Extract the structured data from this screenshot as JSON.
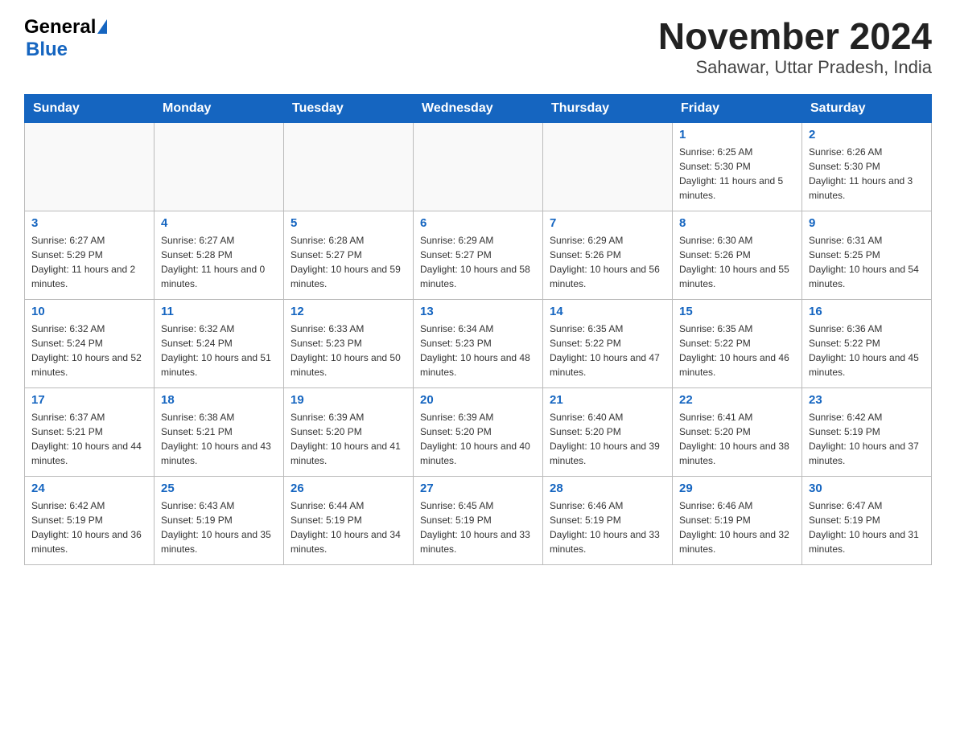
{
  "header": {
    "logo_general": "General",
    "logo_blue": "Blue",
    "title": "November 2024",
    "subtitle": "Sahawar, Uttar Pradesh, India"
  },
  "calendar": {
    "days_of_week": [
      "Sunday",
      "Monday",
      "Tuesday",
      "Wednesday",
      "Thursday",
      "Friday",
      "Saturday"
    ],
    "weeks": [
      [
        {
          "day": "",
          "info": ""
        },
        {
          "day": "",
          "info": ""
        },
        {
          "day": "",
          "info": ""
        },
        {
          "day": "",
          "info": ""
        },
        {
          "day": "",
          "info": ""
        },
        {
          "day": "1",
          "info": "Sunrise: 6:25 AM\nSunset: 5:30 PM\nDaylight: 11 hours and 5 minutes."
        },
        {
          "day": "2",
          "info": "Sunrise: 6:26 AM\nSunset: 5:30 PM\nDaylight: 11 hours and 3 minutes."
        }
      ],
      [
        {
          "day": "3",
          "info": "Sunrise: 6:27 AM\nSunset: 5:29 PM\nDaylight: 11 hours and 2 minutes."
        },
        {
          "day": "4",
          "info": "Sunrise: 6:27 AM\nSunset: 5:28 PM\nDaylight: 11 hours and 0 minutes."
        },
        {
          "day": "5",
          "info": "Sunrise: 6:28 AM\nSunset: 5:27 PM\nDaylight: 10 hours and 59 minutes."
        },
        {
          "day": "6",
          "info": "Sunrise: 6:29 AM\nSunset: 5:27 PM\nDaylight: 10 hours and 58 minutes."
        },
        {
          "day": "7",
          "info": "Sunrise: 6:29 AM\nSunset: 5:26 PM\nDaylight: 10 hours and 56 minutes."
        },
        {
          "day": "8",
          "info": "Sunrise: 6:30 AM\nSunset: 5:26 PM\nDaylight: 10 hours and 55 minutes."
        },
        {
          "day": "9",
          "info": "Sunrise: 6:31 AM\nSunset: 5:25 PM\nDaylight: 10 hours and 54 minutes."
        }
      ],
      [
        {
          "day": "10",
          "info": "Sunrise: 6:32 AM\nSunset: 5:24 PM\nDaylight: 10 hours and 52 minutes."
        },
        {
          "day": "11",
          "info": "Sunrise: 6:32 AM\nSunset: 5:24 PM\nDaylight: 10 hours and 51 minutes."
        },
        {
          "day": "12",
          "info": "Sunrise: 6:33 AM\nSunset: 5:23 PM\nDaylight: 10 hours and 50 minutes."
        },
        {
          "day": "13",
          "info": "Sunrise: 6:34 AM\nSunset: 5:23 PM\nDaylight: 10 hours and 48 minutes."
        },
        {
          "day": "14",
          "info": "Sunrise: 6:35 AM\nSunset: 5:22 PM\nDaylight: 10 hours and 47 minutes."
        },
        {
          "day": "15",
          "info": "Sunrise: 6:35 AM\nSunset: 5:22 PM\nDaylight: 10 hours and 46 minutes."
        },
        {
          "day": "16",
          "info": "Sunrise: 6:36 AM\nSunset: 5:22 PM\nDaylight: 10 hours and 45 minutes."
        }
      ],
      [
        {
          "day": "17",
          "info": "Sunrise: 6:37 AM\nSunset: 5:21 PM\nDaylight: 10 hours and 44 minutes."
        },
        {
          "day": "18",
          "info": "Sunrise: 6:38 AM\nSunset: 5:21 PM\nDaylight: 10 hours and 43 minutes."
        },
        {
          "day": "19",
          "info": "Sunrise: 6:39 AM\nSunset: 5:20 PM\nDaylight: 10 hours and 41 minutes."
        },
        {
          "day": "20",
          "info": "Sunrise: 6:39 AM\nSunset: 5:20 PM\nDaylight: 10 hours and 40 minutes."
        },
        {
          "day": "21",
          "info": "Sunrise: 6:40 AM\nSunset: 5:20 PM\nDaylight: 10 hours and 39 minutes."
        },
        {
          "day": "22",
          "info": "Sunrise: 6:41 AM\nSunset: 5:20 PM\nDaylight: 10 hours and 38 minutes."
        },
        {
          "day": "23",
          "info": "Sunrise: 6:42 AM\nSunset: 5:19 PM\nDaylight: 10 hours and 37 minutes."
        }
      ],
      [
        {
          "day": "24",
          "info": "Sunrise: 6:42 AM\nSunset: 5:19 PM\nDaylight: 10 hours and 36 minutes."
        },
        {
          "day": "25",
          "info": "Sunrise: 6:43 AM\nSunset: 5:19 PM\nDaylight: 10 hours and 35 minutes."
        },
        {
          "day": "26",
          "info": "Sunrise: 6:44 AM\nSunset: 5:19 PM\nDaylight: 10 hours and 34 minutes."
        },
        {
          "day": "27",
          "info": "Sunrise: 6:45 AM\nSunset: 5:19 PM\nDaylight: 10 hours and 33 minutes."
        },
        {
          "day": "28",
          "info": "Sunrise: 6:46 AM\nSunset: 5:19 PM\nDaylight: 10 hours and 33 minutes."
        },
        {
          "day": "29",
          "info": "Sunrise: 6:46 AM\nSunset: 5:19 PM\nDaylight: 10 hours and 32 minutes."
        },
        {
          "day": "30",
          "info": "Sunrise: 6:47 AM\nSunset: 5:19 PM\nDaylight: 10 hours and 31 minutes."
        }
      ]
    ]
  }
}
